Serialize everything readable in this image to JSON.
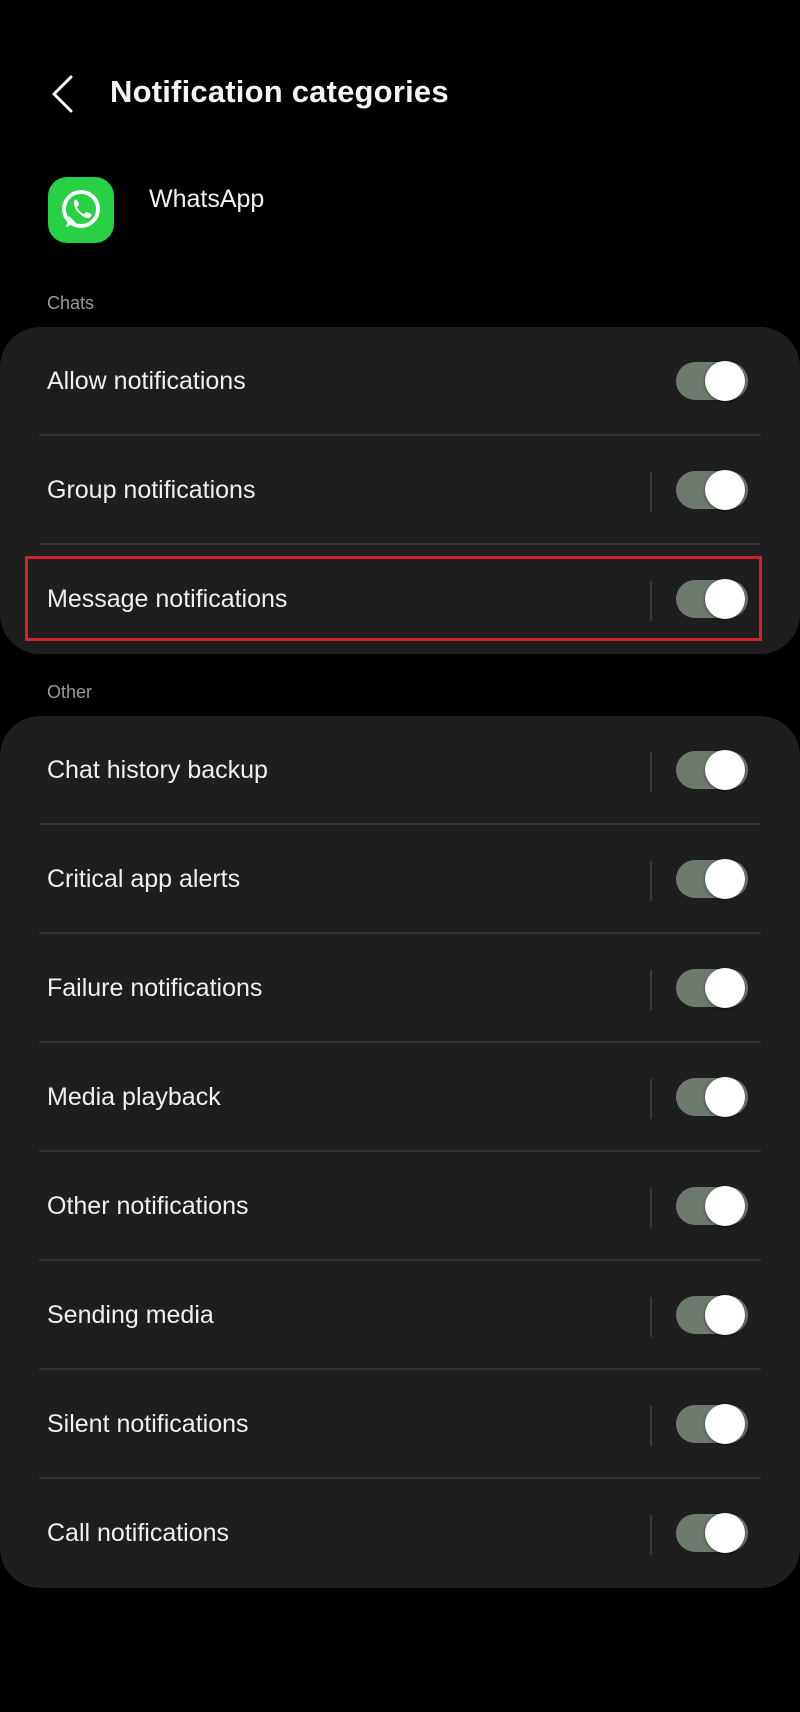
{
  "header": {
    "title": "Notification categories",
    "back_icon": "chevron-left-icon"
  },
  "app": {
    "name": "WhatsApp",
    "icon": "whatsapp-logo-icon",
    "icon_color": "#27d045"
  },
  "sections": [
    {
      "label": "Chats",
      "items": [
        {
          "label": "Allow notifications",
          "enabled": true,
          "has_separator": false
        },
        {
          "label": "Group notifications",
          "enabled": true,
          "has_separator": true
        },
        {
          "label": "Message notifications",
          "enabled": true,
          "has_separator": true,
          "highlighted": true
        }
      ]
    },
    {
      "label": "Other",
      "items": [
        {
          "label": "Chat history backup",
          "enabled": true,
          "has_separator": true
        },
        {
          "label": "Critical app alerts",
          "enabled": true,
          "has_separator": true
        },
        {
          "label": "Failure notifications",
          "enabled": true,
          "has_separator": true
        },
        {
          "label": "Media playback",
          "enabled": true,
          "has_separator": true
        },
        {
          "label": "Other notifications",
          "enabled": true,
          "has_separator": true
        },
        {
          "label": "Sending media",
          "enabled": true,
          "has_separator": true
        },
        {
          "label": "Silent notifications",
          "enabled": true,
          "has_separator": true
        },
        {
          "label": "Call notifications",
          "enabled": true,
          "has_separator": true
        }
      ]
    }
  ],
  "colors": {
    "background": "#000000",
    "card": "#1e1e1e",
    "toggle_track_on": "#6f7a6f",
    "highlight": "#d0222a"
  }
}
